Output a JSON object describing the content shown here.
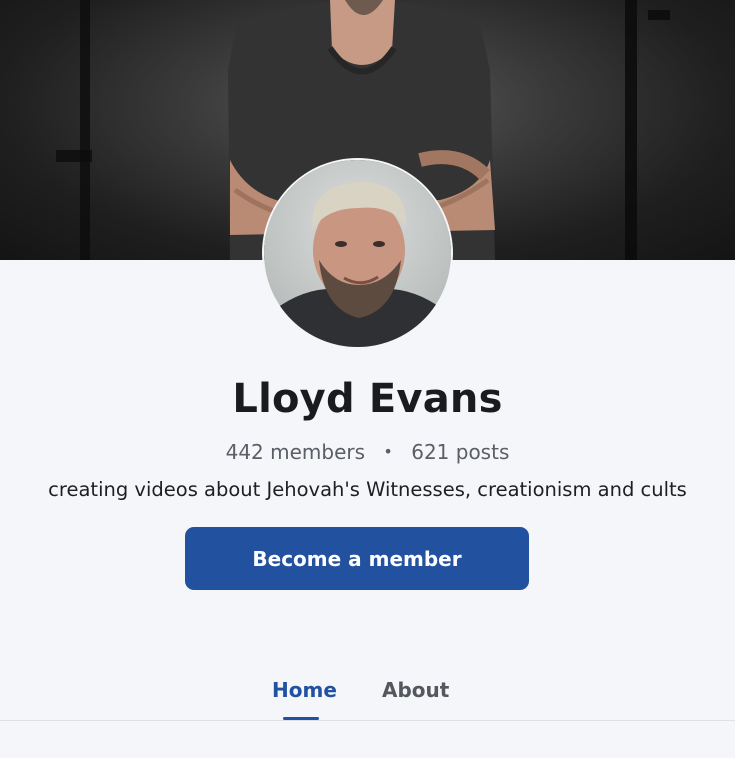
{
  "profile": {
    "name": "Lloyd Evans",
    "members": "442 members",
    "separator": "•",
    "posts": "621 posts",
    "bio": "creating videos about Jehovah's Witnesses, creationism and cults"
  },
  "actions": {
    "become_member_label": "Become a member"
  },
  "tabs": [
    {
      "label": "Home",
      "active": true
    },
    {
      "label": "About",
      "active": false
    }
  ],
  "colors": {
    "accent": "#2251a0",
    "background": "#f5f6fa",
    "text": "#1a1b1e",
    "muted": "#5b5e66"
  }
}
